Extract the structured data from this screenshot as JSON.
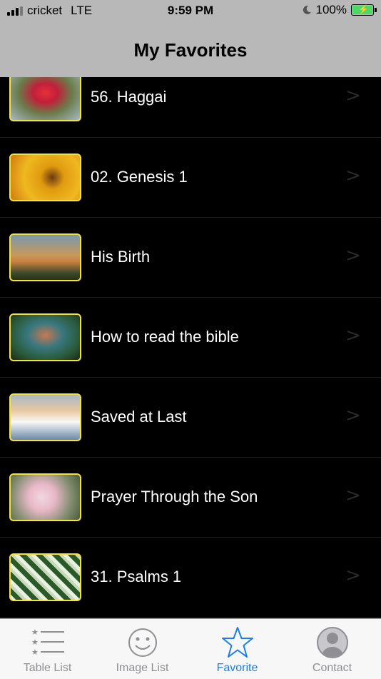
{
  "status_bar": {
    "carrier": "cricket",
    "network": "LTE",
    "time": "9:59 PM",
    "battery": "100%",
    "signal_bars": 3,
    "signal_bars_max": 4
  },
  "nav": {
    "title": "My Favorites"
  },
  "favorites": [
    {
      "label": "56. Haggai",
      "thumb_icon": "red-flower-thumbnail"
    },
    {
      "label": "02. Genesis 1",
      "thumb_icon": "autumn-tree-thumbnail"
    },
    {
      "label": "His Birth",
      "thumb_icon": "sunset-tree-thumbnail"
    },
    {
      "label": "How to read the bible",
      "thumb_icon": "underwater-thumbnail"
    },
    {
      "label": "Saved at Last",
      "thumb_icon": "snow-landscape-thumbnail"
    },
    {
      "label": "Prayer Through the Son",
      "thumb_icon": "blossom-thumbnail"
    },
    {
      "label": "31. Psalms 1",
      "thumb_icon": "leaves-thumbnail"
    }
  ],
  "tabs": [
    {
      "label": "Table List",
      "icon": "list-icon",
      "active": false
    },
    {
      "label": "Image List",
      "icon": "smiley-icon",
      "active": false
    },
    {
      "label": "Favorite",
      "icon": "star-icon",
      "active": true
    },
    {
      "label": "Contact",
      "icon": "person-icon",
      "active": false
    }
  ],
  "colors": {
    "accent": "#1a7cf0",
    "thumb_border": "#f2e23a",
    "bar_bg": "#b8b8b8",
    "inactive_tab": "#8e8e93"
  }
}
